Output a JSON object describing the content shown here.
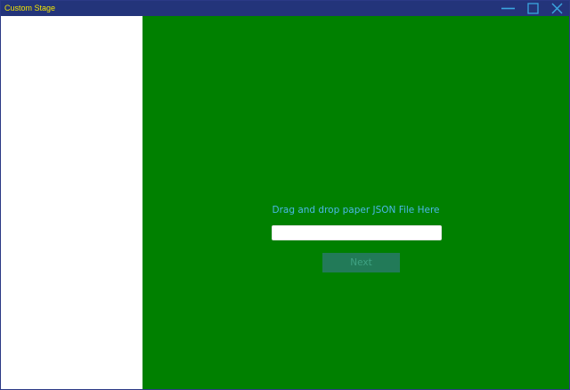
{
  "window": {
    "title": "Custom Stage",
    "controls": {
      "minimize": "minimize-icon",
      "maximize": "maximize-icon",
      "close": "close-icon"
    },
    "colors": {
      "titlebar": "#23347a",
      "title_text": "#f2e400",
      "control_icons": "#3aa6e0"
    }
  },
  "main": {
    "drop_label": "Drag and drop paper JSON File Here",
    "file_input": {
      "value": "",
      "placeholder": ""
    },
    "next_label": "Next",
    "colors": {
      "background": "#008000",
      "drop_label": "#4cb8e8",
      "next_button_bg": "#227a58",
      "next_button_text": "#3fa283"
    }
  }
}
